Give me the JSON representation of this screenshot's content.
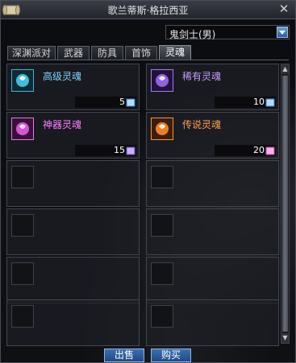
{
  "window": {
    "title": "歌兰蒂斯·格拉西亚"
  },
  "dropdown": {
    "selected": "鬼剑士(男)"
  },
  "tabs": [
    {
      "label": "深渊派对",
      "active": false
    },
    {
      "label": "武器",
      "active": false
    },
    {
      "label": "防具",
      "active": false
    },
    {
      "label": "首饰",
      "active": false
    },
    {
      "label": "灵魂",
      "active": true
    }
  ],
  "items": [
    {
      "name": "高级灵魂",
      "qty": "5",
      "color": "#7fd4ff",
      "icon": "soul-blue-icon"
    },
    {
      "name": "稀有灵魂",
      "qty": "10",
      "color": "#c89cff",
      "icon": "soul-purple-icon"
    },
    {
      "name": "神器灵魂",
      "qty": "15",
      "color": "#ff7fff",
      "icon": "soul-pink-icon"
    },
    {
      "name": "传说灵魂",
      "qty": "20",
      "color": "#ffa050",
      "icon": "soul-orange-icon"
    }
  ],
  "buttons": {
    "sell": "出售",
    "buy": "购买"
  }
}
